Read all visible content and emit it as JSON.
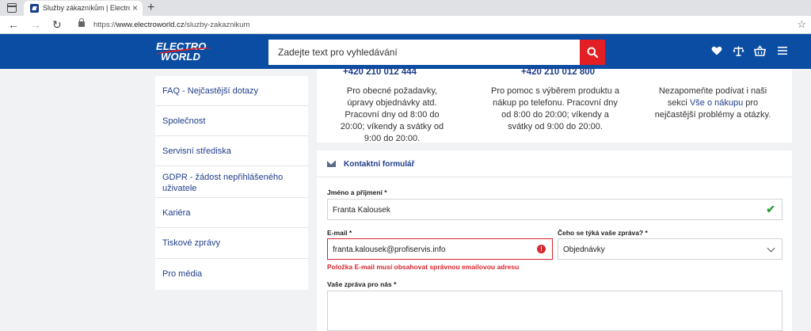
{
  "browser": {
    "tab_title": "Služby zákazníkům | Electroworld",
    "tab_close": "×",
    "new_tab": "+",
    "url_prefix": "https://",
    "url_host": "www.electroworld.cz",
    "url_path": "/sluzby-zakaznikum"
  },
  "header": {
    "logo_line1": "ELECTRO",
    "logo_line2": "WORLD",
    "search_placeholder": "Zadejte text pro vyhledávání",
    "icons": [
      "heart-icon",
      "compare-icon",
      "basket-icon",
      "menu-icon"
    ]
  },
  "sidebar": {
    "items": [
      {
        "label": "FAQ - Nejčastější dotazy"
      },
      {
        "label": "Společnost"
      },
      {
        "label": "Servisní střediska"
      },
      {
        "label": "GDPR - žádost nepřihlášeného uživatele"
      },
      {
        "label": "Kariéra"
      },
      {
        "label": "Tiskové zprávy"
      },
      {
        "label": "Pro média"
      }
    ]
  },
  "info": {
    "col1_phone": "+420 210 012 444",
    "col1_text": "Pro obecné požadavky, úpravy objednávky atd. Pracovní dny od 8:00 do 20:00; víkendy a svátky od 9:00 do 20:00.",
    "col2_phone": "+420 210 012 800",
    "col2_text": "Pro pomoc s výběrem produktu a nákup po telefonu. Pracovní dny od 8:00 do 20:00; víkendy a svátky od 9:00 do 20:00.",
    "col3_text_before": "Nezapomeňte podívat i naši sekci ",
    "col3_link": "Vše o nákupu",
    "col3_text_after": " pro nejčastější problémy a otázky."
  },
  "form": {
    "title": "Kontaktní formulář",
    "name_label": "Jméno a příjmení *",
    "name_value": "Franta Kalousek",
    "email_label": "E-mail *",
    "email_value": "franta.kalousek@profiservis.info",
    "email_error": "Položka E-mail musí obsahovat správnou emailovou adresu",
    "topic_label": "Čeho se týká vaše zpráva? *",
    "topic_value": "Objednávky",
    "message_label": "Vaše zpráva pro nás *",
    "error_glyph": "!",
    "ok_glyph": "✔"
  }
}
